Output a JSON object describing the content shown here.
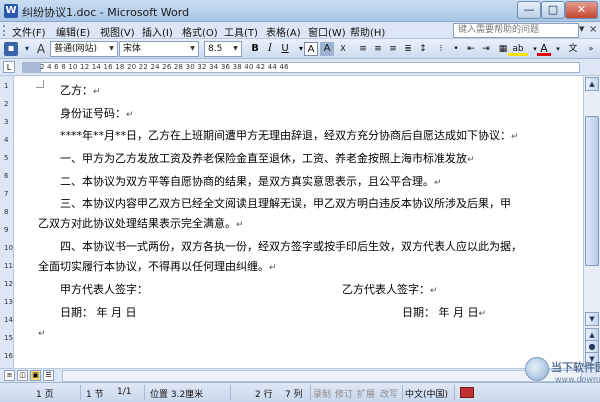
{
  "window": {
    "title": "纠纷协议1.doc - Microsoft Word",
    "min": "—",
    "max": "□",
    "close": "✕"
  },
  "menu": {
    "items": [
      "文件(F)",
      "编辑(E)",
      "视图(V)",
      "插入(I)",
      "格式(O)",
      "工具(T)",
      "表格(A)",
      "窗口(W)",
      "帮助(H)"
    ],
    "help_placeholder": "键入需要帮助的问题",
    "close": "×"
  },
  "toolbar": {
    "style": "普通(网站)",
    "font": "宋体",
    "size": "8.5",
    "bold": "B",
    "italic": "I",
    "underline": "U",
    "char_a": "A",
    "char_a2": "A",
    "highlight": "ab",
    "fontcolor": "A"
  },
  "ruler": {
    "ticks": "2   4   6   8   10   12   14   16   18   20   22   24   26   28   30   32   34   36   38   40   42   44   46"
  },
  "vruler": [
    "1",
    "2",
    "3",
    "4",
    "5",
    "6",
    "7",
    "8",
    "9",
    "10",
    "11",
    "12",
    "13",
    "14",
    "15",
    "16"
  ],
  "document": {
    "lines": [
      "乙方：",
      "身份证号码：",
      "****年**月**日，乙方在上班期间遭甲方无理由辞退，经双方充分协商后自愿达成如下协议：",
      "一、甲方为乙方发放工资及养老保险金直至退休，工资、养老金按照上海市标准发放",
      "二、本协议为双方平等自愿协商的结果，是双方真实意思表示，且公平合理。",
      "三、本协议内容甲乙双方已经全文阅读且理解无误，甲乙双方明白违反本协议所涉及后果，甲",
      "乙双方对此协议处理结果表示完全满意。",
      "四、本协议书一式两份，双方各执一份，经双方签字或按手印后生效，双方代表人应以此为据，",
      "全面切实履行本协议，不得再以任何理由纠缠。"
    ],
    "sign_left": "甲方代表人签字：",
    "sign_right": "乙方代表人签字：",
    "date_left": "日期：  年  月  日",
    "date_right": "日期：  年  月  日",
    "pilcrow": "↵"
  },
  "status": {
    "page": "1 页",
    "section": "1 节",
    "pages": "1/1",
    "position": "位置 3.2厘米",
    "row": "2 行",
    "col": "7 列",
    "rec": "录制",
    "trk": "修订",
    "ext": "扩展",
    "ovr": "改写",
    "lang": "中文(中国)"
  },
  "watermark": {
    "name": "当下软件园",
    "url": "www.downxia.com"
  }
}
